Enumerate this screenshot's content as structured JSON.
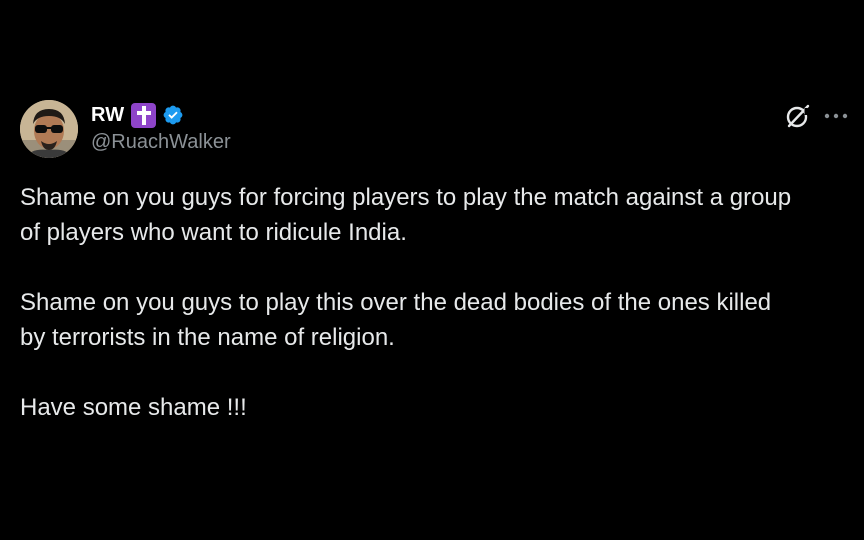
{
  "tweet": {
    "author": {
      "display_name": "RW",
      "handle": "@RuachWalker",
      "avatar_icon": "user-avatar-sunglasses",
      "badges": [
        "latin-cross-icon",
        "verified-badge-icon"
      ]
    },
    "header_actions": [
      "grok-icon",
      "more-options-icon"
    ],
    "paragraphs": [
      "Shame on you guys for forcing players to play the match against a group\nof players who want to ridicule India.",
      "Shame on you guys to play this over the dead bodies of the ones killed\nby terrorists in the name of religion.",
      "Have some shame !!!"
    ]
  },
  "colors": {
    "background": "#000000",
    "text": "#e7e9ea",
    "secondary_text": "#8b9196",
    "verified_blue": "#1d9bf0",
    "cross_badge_purple": "#8e44c9"
  }
}
